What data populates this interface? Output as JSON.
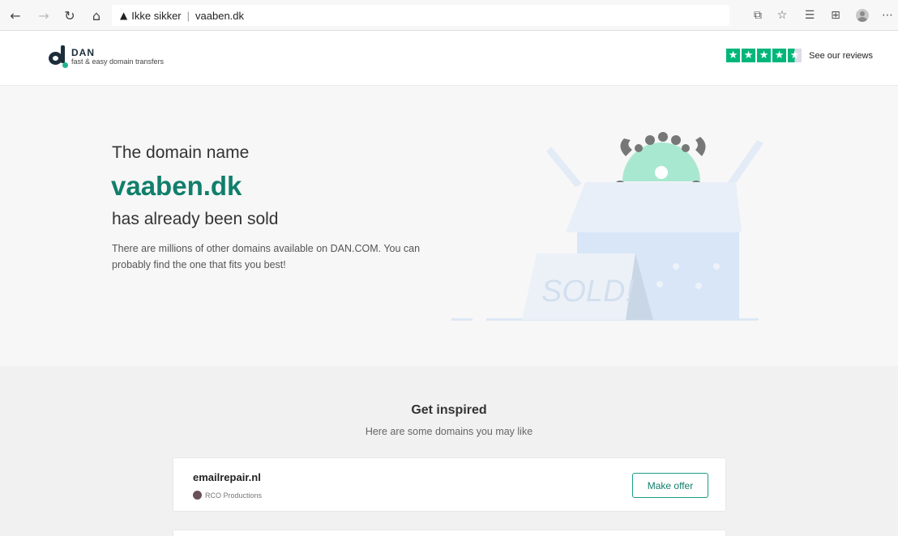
{
  "browser": {
    "address_warning": "Ikke sikker",
    "url": "vaaben.dk"
  },
  "header": {
    "brand": "DAN",
    "tagline": "fast & easy domain transfers",
    "reviews_label": "See our reviews",
    "rating": 4.5
  },
  "hero": {
    "pre_text": "The domain name",
    "domain": "vaaben.dk",
    "post_text": "has already been sold",
    "description": "There are millions of other domains available on DAN.COM. You can probably find the one that fits you best!",
    "sign_text": "SOLD!"
  },
  "inspire": {
    "title": "Get inspired",
    "subtitle": "Here are some domains you may like",
    "cards": [
      {
        "domain": "emailrepair.nl",
        "seller": "RCO Productions",
        "button": "Make offer"
      }
    ]
  },
  "colors": {
    "accent": "#117f6b",
    "trustpilot": "#00b67a"
  }
}
